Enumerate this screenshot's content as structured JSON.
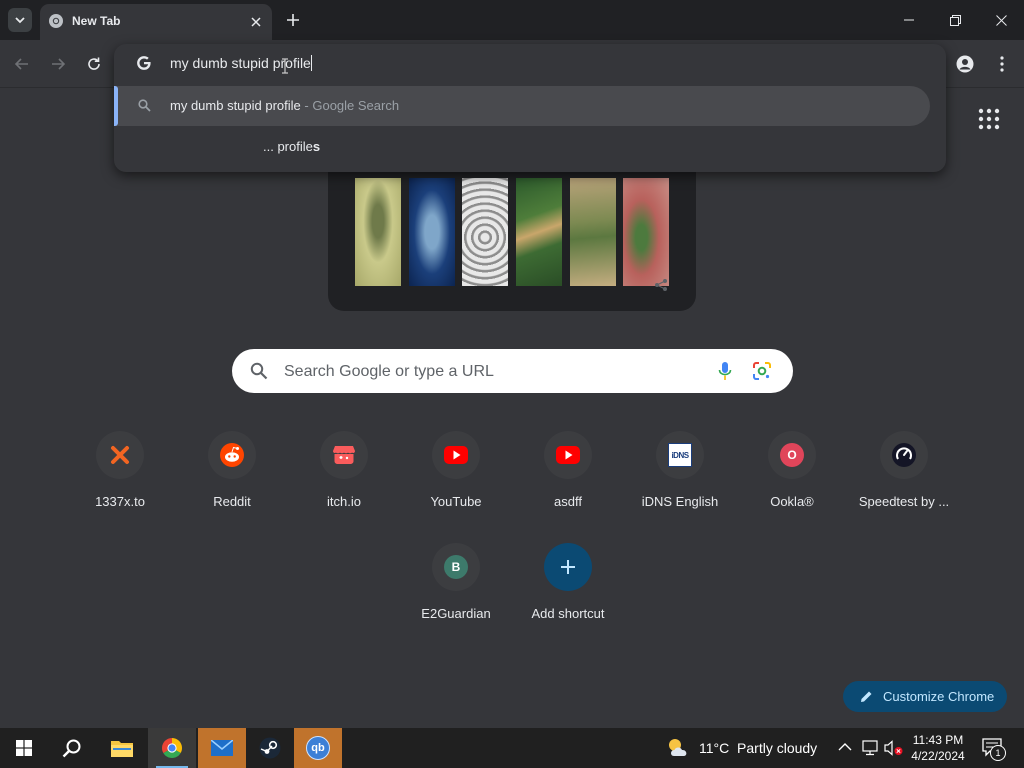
{
  "browser": {
    "tab": {
      "title": "New Tab"
    }
  },
  "omnibox": {
    "input_text": "my dumb stupid profile",
    "suggestions": [
      {
        "text": "my dumb stupid profile",
        "suffix": "- Google Search",
        "selected": true,
        "icon": "search-icon"
      },
      {
        "prefix": "... profile",
        "bold": "s",
        "selected": false
      }
    ]
  },
  "search": {
    "placeholder": "Search Google or type a URL"
  },
  "shortcuts": [
    {
      "label": "1337x.to",
      "icon": "1337x-icon"
    },
    {
      "label": "Reddit",
      "icon": "reddit-icon"
    },
    {
      "label": "itch.io",
      "icon": "itchio-icon"
    },
    {
      "label": "YouTube",
      "icon": "youtube-icon"
    },
    {
      "label": "asdff",
      "icon": "youtube-icon"
    },
    {
      "label": "iDNS English",
      "icon": "idns-icon",
      "icon_text": "iDNS"
    },
    {
      "label": "Ookla®",
      "icon": "ookla-letter-icon",
      "letter": "O",
      "color": "#e0455a"
    },
    {
      "label": "Speedtest by ...",
      "icon": "speedtest-icon"
    },
    {
      "label": "E2Guardian",
      "icon": "e2guardian-letter-icon",
      "letter": "B",
      "color": "#3d7a6b"
    },
    {
      "label": "Add shortcut",
      "icon": "plus-icon"
    }
  ],
  "customize": {
    "label": "Customize Chrome"
  },
  "taskbar": {
    "weather": {
      "temp": "11°C",
      "condition": "Partly cloudy"
    },
    "clock": {
      "time": "11:43 PM",
      "date": "4/22/2024"
    },
    "notification_count": "1",
    "qbittorrent_label": "qb"
  },
  "colors": {
    "chrome_bg": "#35363a",
    "tabstrip_bg": "#202124",
    "accent_blue": "#8ab4f8",
    "customize_bg": "#0b4a73",
    "taskbar_bg": "#202020"
  }
}
